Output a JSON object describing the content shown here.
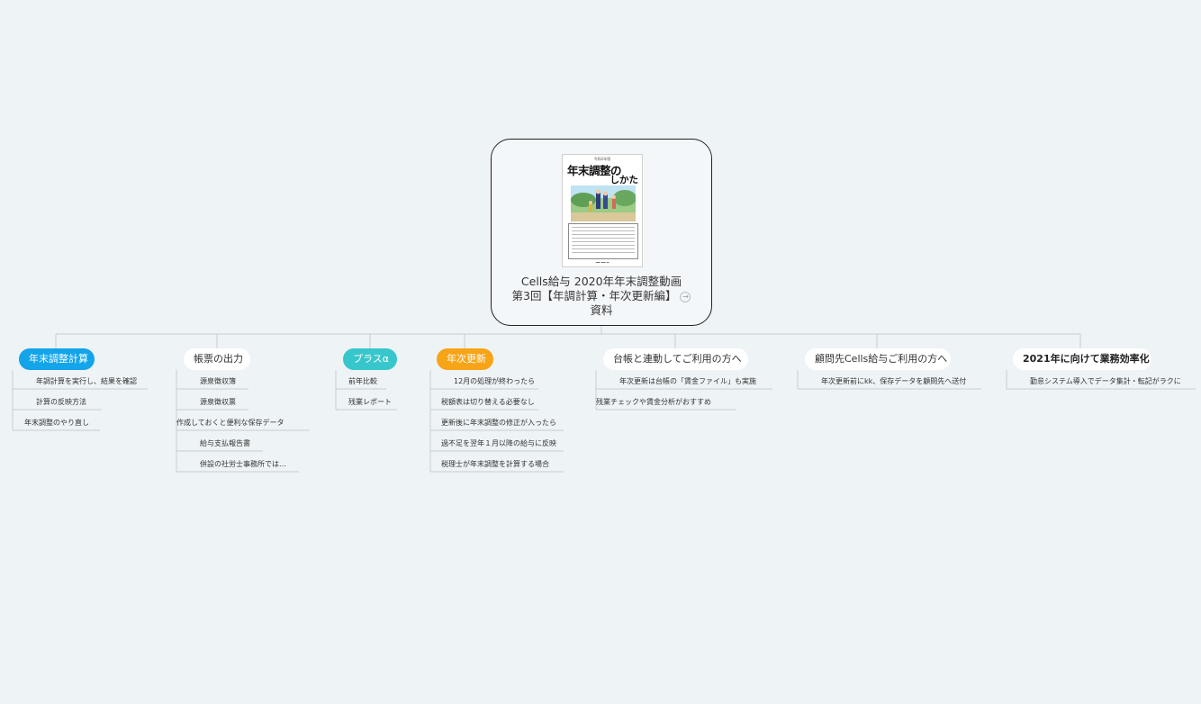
{
  "central": {
    "book_publisher": "令和2年版",
    "book_title_line1": "年末調整の",
    "book_title_line2": "しかた",
    "title_line1": "Cells給与 2020年年末調整動画",
    "title_line2": "第3回【年調計算・年次更新編】",
    "title_line3": "資料"
  },
  "colors": {
    "blue": "#13a4ea",
    "teal": "#37c6cb",
    "orange": "#f7a417",
    "line": "#c5cdd2"
  },
  "topics": [
    {
      "label": "年末調整計算",
      "children": [
        "年調計算を実行し、結果を確認",
        "計算の反映方法",
        "年末調整のやり直し"
      ]
    },
    {
      "label": "帳票の出力",
      "children": [
        "源泉徴収簿",
        "源泉徴収票",
        "作成しておくと便利な保存データ",
        "給与支払報告書",
        "併設の社労士事務所では…"
      ]
    },
    {
      "label": "プラスα",
      "children": [
        "前年比較",
        "残業レポート"
      ]
    },
    {
      "label": "年次更新",
      "children": [
        "12月の処理が終わったら",
        "税額表は切り替える必要なし",
        "更新後に年末調整の修正が入ったら",
        "過不足を翌年１月以降の給与に反映",
        "税理士が年末調整を計算する場合"
      ]
    },
    {
      "label": "台帳と連動してご利用の方へ",
      "children": [
        "年次更新は台帳の「賃金ファイル」も実施",
        "残業チェックや賃金分析がおすすめ"
      ]
    },
    {
      "label": "顧問先Cells給与ご利用の方へ",
      "children": [
        "年次更新前にkk、保存データを顧問先へ送付"
      ]
    },
    {
      "label": "2021年に向けて業務効率化",
      "children": [
        "勤怠システム導入でデータ集計・転記がラクに"
      ]
    }
  ]
}
